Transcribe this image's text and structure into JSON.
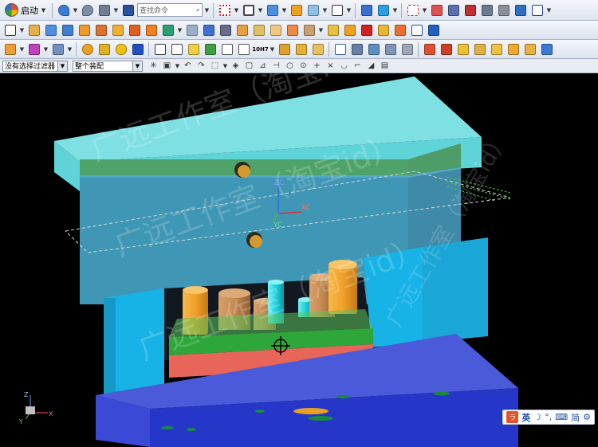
{
  "toolbar1": {
    "start_label": "启动",
    "search_placeholder": "查找命令"
  },
  "selection_bar": {
    "filter_value": "没有选择过滤器",
    "scope_value": "整个装配",
    "measure_button_label": "10H7"
  },
  "viewport": {
    "view_axes": {
      "z": "ZC",
      "x": "XC",
      "y": "YC"
    },
    "triad": {
      "z": "Z",
      "x": "X",
      "y": "Y"
    },
    "watermark": [
      "广远工作室（淘宝id）",
      "广远工作室（淘宝id）",
      "广远工作室（淘宝id）",
      "广远工作室（淘宝id）"
    ]
  },
  "ime_bar": {
    "logo": "ラ",
    "lang": "英",
    "moon": "☽",
    "punct": "°,",
    "keyboard": "⌨",
    "simp": "简",
    "settings": "⚙"
  },
  "colors": {
    "top_plate": "#5fd4d8",
    "a_plate_upper": "#4fa36a",
    "a_plate_lower": "#3f97b5",
    "support_block": "#17b2e6",
    "ejector_top": "#2fa63a",
    "ejector_bottom": "#e8655a",
    "bottom_plate": "#3a49d6",
    "pillar_orange": "#f0a12b",
    "pillar_brown": "#c48a52",
    "pillar_cyan": "#1fd0dc"
  }
}
